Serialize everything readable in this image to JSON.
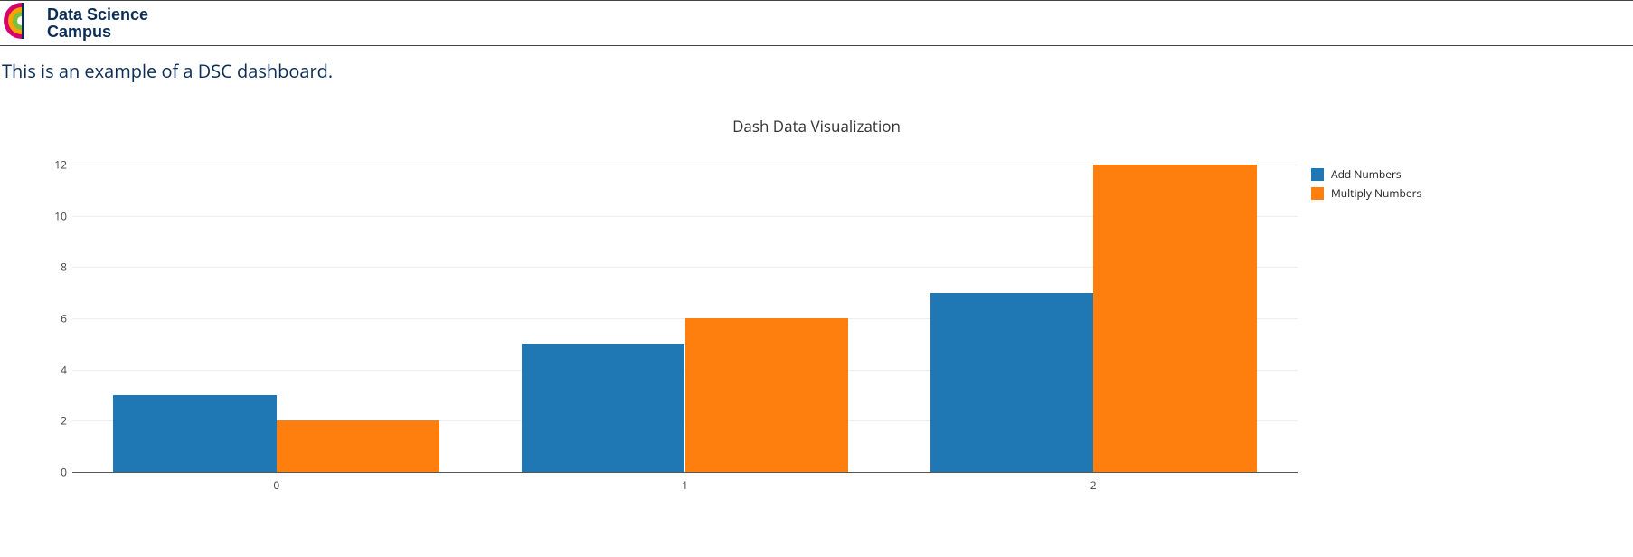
{
  "brand": {
    "line1": "Data Science",
    "line2": "Campus"
  },
  "tagline": "This is an example of a DSC dashboard.",
  "chart_data": {
    "type": "bar",
    "title": "Dash Data Visualization",
    "categories": [
      "0",
      "1",
      "2"
    ],
    "series": [
      {
        "name": "Add Numbers",
        "color": "#1f77b4",
        "values": [
          3,
          5,
          7
        ]
      },
      {
        "name": "Multiply Numbers",
        "color": "#ff7f0e",
        "values": [
          2,
          6,
          12
        ]
      }
    ],
    "ylim": [
      0,
      12
    ],
    "yticks": [
      0,
      2,
      4,
      6,
      8,
      10,
      12
    ],
    "xlabel": "",
    "ylabel": "",
    "grid": true,
    "legend_position": "right"
  }
}
